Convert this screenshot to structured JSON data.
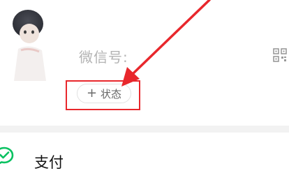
{
  "profile": {
    "wechat_id_label": "微信号:",
    "status_button_label": "状态",
    "status_plus_glyph": "+",
    "icons": {
      "avatar": "avatar",
      "qr_code": "qr-code-icon"
    }
  },
  "annotation": {
    "color": "#e8272c"
  },
  "menu": {
    "items": [
      {
        "label": "支付",
        "icon": "wechat-pay-icon",
        "icon_color": "#07c160"
      }
    ]
  }
}
